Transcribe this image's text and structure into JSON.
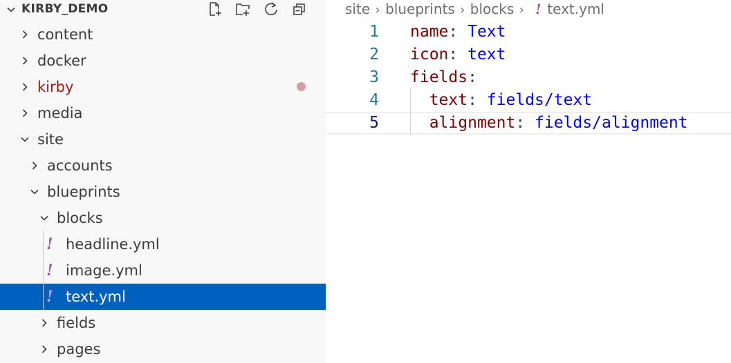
{
  "explorer": {
    "root_label": "KIRBY_DEMO",
    "actions": [
      {
        "name": "new-file-icon"
      },
      {
        "name": "new-folder-icon"
      },
      {
        "name": "refresh-icon"
      },
      {
        "name": "collapse-all-icon"
      }
    ],
    "items": [
      {
        "label": "content",
        "kind": "folder",
        "expanded": false,
        "depth": 0
      },
      {
        "label": "docker",
        "kind": "folder",
        "expanded": false,
        "depth": 0
      },
      {
        "label": "kirby",
        "kind": "folder",
        "expanded": false,
        "depth": 0,
        "modified": true
      },
      {
        "label": "media",
        "kind": "folder",
        "expanded": false,
        "depth": 0
      },
      {
        "label": "site",
        "kind": "folder",
        "expanded": true,
        "depth": 0
      },
      {
        "label": "accounts",
        "kind": "folder",
        "expanded": false,
        "depth": 1
      },
      {
        "label": "blueprints",
        "kind": "folder",
        "expanded": true,
        "depth": 1
      },
      {
        "label": "blocks",
        "kind": "folder",
        "expanded": true,
        "depth": 2
      },
      {
        "label": "headline.yml",
        "kind": "file",
        "icon": "!",
        "depth": 3
      },
      {
        "label": "image.yml",
        "kind": "file",
        "icon": "!",
        "depth": 3
      },
      {
        "label": "text.yml",
        "kind": "file",
        "icon": "!",
        "depth": 3,
        "selected": true
      },
      {
        "label": "fields",
        "kind": "folder",
        "expanded": false,
        "depth": 2
      },
      {
        "label": "pages",
        "kind": "folder",
        "expanded": false,
        "depth": 2
      }
    ]
  },
  "breadcrumb": {
    "items": [
      "site",
      "blueprints",
      "blocks"
    ],
    "file_icon": "!",
    "file": "text.yml"
  },
  "editor": {
    "active_line": 5,
    "lines": [
      {
        "num": "1",
        "indent": "",
        "key": "name",
        "value": "Text"
      },
      {
        "num": "2",
        "indent": "",
        "key": "icon",
        "value": "text"
      },
      {
        "num": "3",
        "indent": "",
        "key": "fields",
        "value": ""
      },
      {
        "num": "4",
        "indent": "  ",
        "key": "text",
        "value": "fields/text"
      },
      {
        "num": "5",
        "indent": "  ",
        "key": "alignment",
        "value": "fields/alignment"
      }
    ]
  },
  "colors": {
    "selection": "#0060c0",
    "modified": "#a31515",
    "yaml_icon": "#9b59b6",
    "yaml_key": "#800000",
    "yaml_value": "#0000ff",
    "line_number": "#237893"
  }
}
